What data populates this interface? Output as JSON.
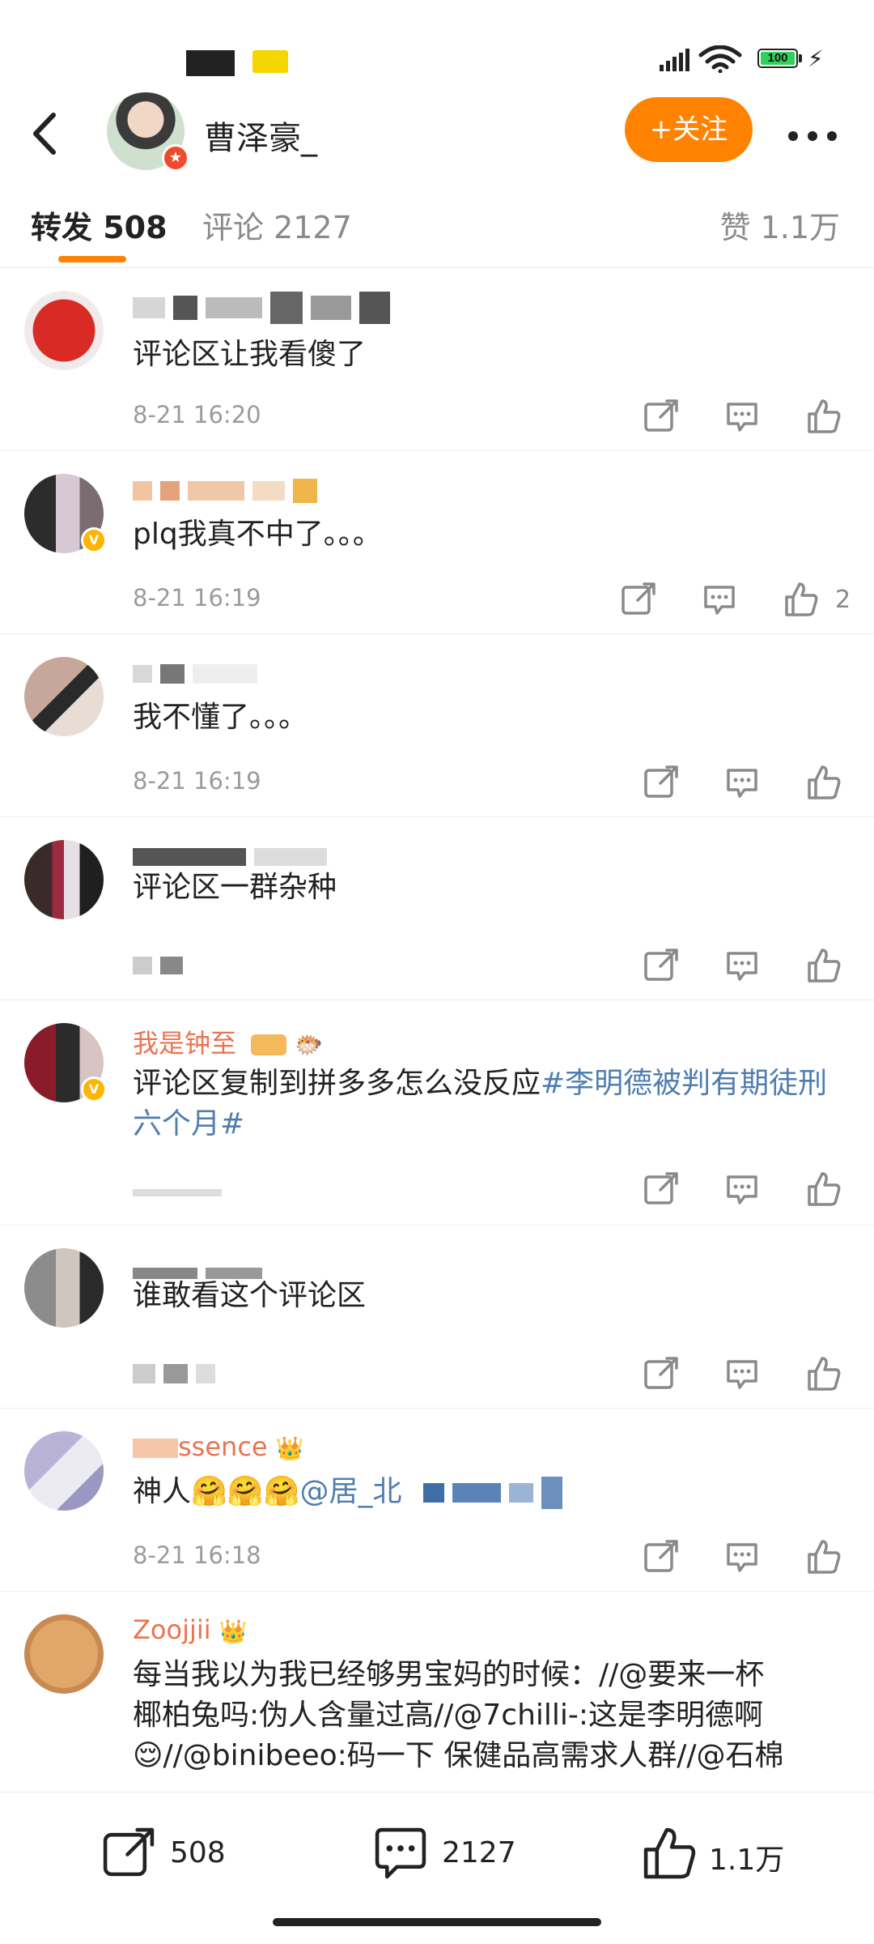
{
  "status_bar": {
    "battery": "100"
  },
  "header": {
    "username": "曹泽豪_",
    "follow_label": "+关注"
  },
  "tabs": {
    "repost": "转发 508",
    "comment": "评论 2127",
    "likes": "赞 1.1万"
  },
  "comments": [
    {
      "text": "评论区让我看傻了",
      "time": "8-21 16:20",
      "likes": ""
    },
    {
      "text": "plq我真不中了。。。",
      "time": "8-21 16:19",
      "likes": "2"
    },
    {
      "text": "我不懂了。。。",
      "time": "8-21 16:19",
      "likes": ""
    },
    {
      "text": "评论区一群杂种",
      "time": "",
      "likes": ""
    },
    {
      "name": "我是钟至",
      "text": "评论区复制到拼多多怎么没反应",
      "topic": "#李明德被判有期徒刑六个月#",
      "time": "",
      "likes": ""
    },
    {
      "text": "谁敢看这个评论区",
      "time": "",
      "likes": ""
    },
    {
      "name": "ssence",
      "text": "神人🤗🤗🤗",
      "mention": "@居_北",
      "time": "8-21 16:18",
      "likes": ""
    },
    {
      "name": "Zoojjii",
      "text_lines": [
        "每当我以为我已经够男宝妈的时候：//@要来一杯",
        "椰柏兔吗:伪人含量过高//@7chilli-:这是李明德啊",
        "😌//@binibeeo:码一下 保健品高需求人群//@石棉"
      ],
      "time": "",
      "likes": ""
    }
  ],
  "bottom_bar": {
    "repost": "508",
    "comment": "2127",
    "like": "1.1万"
  },
  "colors": {
    "accent": "#ff8200",
    "link": "#507daf",
    "secondary_text": "#9b9b9b"
  }
}
